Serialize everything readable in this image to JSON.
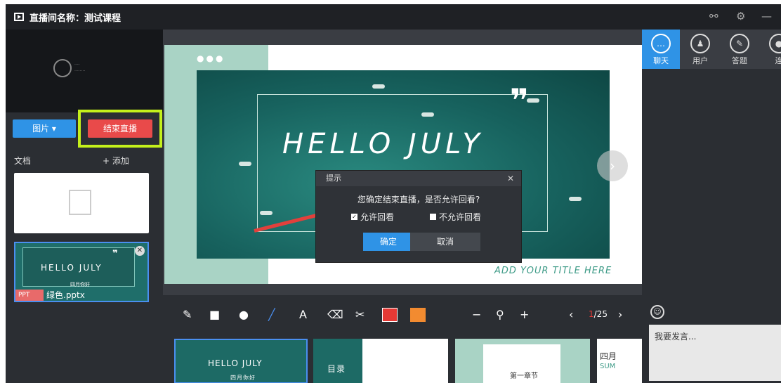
{
  "window": {
    "title": "直播间名称：测试课程"
  },
  "left": {
    "pic_button": "图片 ▾",
    "end_button": "结束直播",
    "doc_label": "文档",
    "add_label": "+ 添加",
    "ppt_title": "HELLO JULY",
    "ppt_sub": "四月你好",
    "ppt_badge": "PPT",
    "ppt_filename": "绿色.pptx"
  },
  "slide": {
    "title": "HELLO JULY",
    "quote": "❞",
    "add_title": "ADD YOUR TITLE HERE",
    "next": "›"
  },
  "dialog": {
    "title": "提示",
    "message": "您确定结束直播，是否允许回看?",
    "allow": "允许回看",
    "disallow": "不允许回看",
    "ok": "确定",
    "cancel": "取消"
  },
  "toolbar": {
    "minus": "−",
    "zoom": "⚲",
    "plus": "+",
    "prev": "‹",
    "page_current": "1",
    "page_total": "/25",
    "next": "›"
  },
  "thumbs": {
    "t1": "HELLO JULY",
    "t1sub": "四月你好",
    "t2": "目录",
    "t3": "第一章节",
    "t4": "四月",
    "t4b": "SUM"
  },
  "right": {
    "tabs": [
      {
        "label": "聊天"
      },
      {
        "label": "用户"
      },
      {
        "label": "答题"
      },
      {
        "label": "连"
      }
    ],
    "input_placeholder": "我要发言..."
  },
  "colors": {
    "accent": "#2f93e6",
    "danger": "#e94a4a",
    "highlight": "#c4f01b"
  }
}
